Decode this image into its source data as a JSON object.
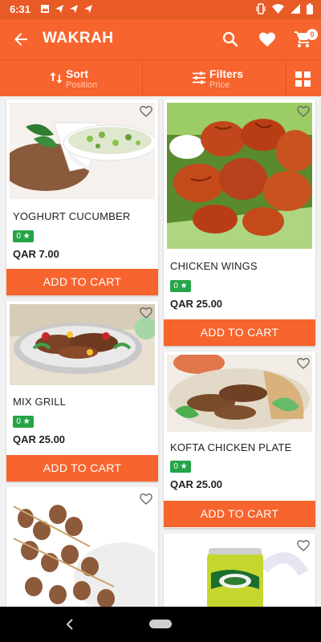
{
  "status_bar": {
    "time": "6:31"
  },
  "app_bar": {
    "title": "WAKRAH",
    "cart_count": "0"
  },
  "filter_bar": {
    "sort": {
      "label": "Sort",
      "sub": "Position"
    },
    "filters": {
      "label": "Filters",
      "sub": "Price"
    }
  },
  "products": [
    {
      "name": "YOGHURT CUCUMBER",
      "rating": "0 ★",
      "price": "QAR 7.00",
      "button": "ADD TO CART"
    },
    {
      "name": "CHICKEN WINGS",
      "rating": "0 ★",
      "price": "QAR 25.00",
      "button": "ADD TO CART"
    },
    {
      "name": "MIX GRILL",
      "rating": "0 ★",
      "price": "QAR 25.00",
      "button": "ADD TO CART"
    },
    {
      "name": "KOFTA CHICKEN PLATE",
      "rating": "0 ★",
      "price": "QAR 25.00",
      "button": "ADD TO CART"
    }
  ],
  "icons": {
    "back": "arrow-back-icon",
    "search": "search-icon",
    "favorite": "heart-icon",
    "cart": "cart-icon",
    "sort": "sort-icon",
    "filters": "sliders-icon",
    "grid": "grid-view-icon",
    "wishlist": "heart-outline-icon"
  },
  "colors": {
    "primary": "#f8642e",
    "status_bar": "#e85a26",
    "rating_badge": "#25a547"
  }
}
